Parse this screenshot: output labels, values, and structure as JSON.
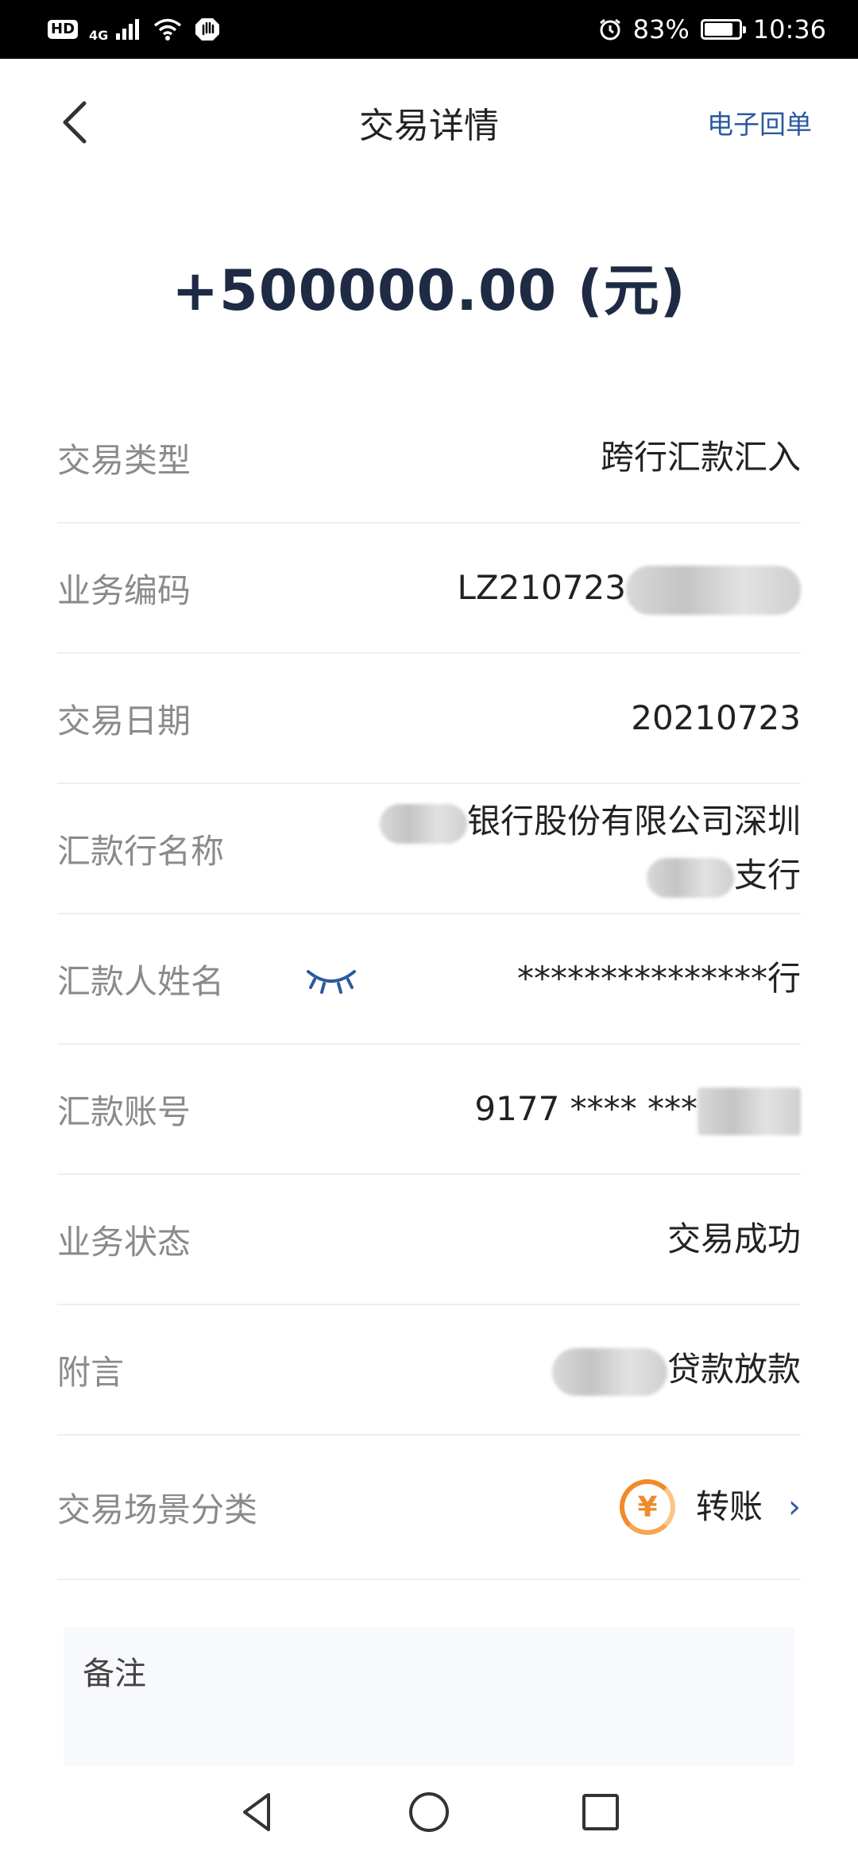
{
  "status_bar": {
    "hd": "HD",
    "network": "4G",
    "battery_percent": "83%",
    "battery_level": 0.83,
    "time": "10:36"
  },
  "header": {
    "title": "交易详情",
    "receipt_link": "电子回单"
  },
  "amount": "+500000.00 (元)",
  "rows": [
    {
      "label": "交易类型",
      "value": "跨行汇款汇入"
    },
    {
      "label": "业务编码",
      "value": "LZ210723"
    },
    {
      "label": "交易日期",
      "value": "20210723"
    },
    {
      "label": "汇款行名称",
      "value_line1": "银行股份有限公司深圳",
      "value_line2": "支行"
    },
    {
      "label": "汇款人姓名",
      "value": "***************行"
    },
    {
      "label": "汇款账号",
      "value": "9177 **** ***"
    },
    {
      "label": "业务状态",
      "value": "交易成功"
    },
    {
      "label": "附言",
      "value": "贷款放款"
    },
    {
      "label": "交易场景分类",
      "value": "转账",
      "icon_glyph": "¥",
      "chevron": "›"
    }
  ],
  "remark": {
    "label": "备注"
  },
  "colors": {
    "accent": "#2c5aa0",
    "amount": "#1f2a44",
    "scene_icon": "#f08a2a"
  },
  "icons": [
    "back-chevron-icon",
    "eye-closed-icon",
    "transfer-yuan-icon",
    "chevron-right-icon",
    "alarm-icon",
    "wifi-icon",
    "signal-icon"
  ]
}
